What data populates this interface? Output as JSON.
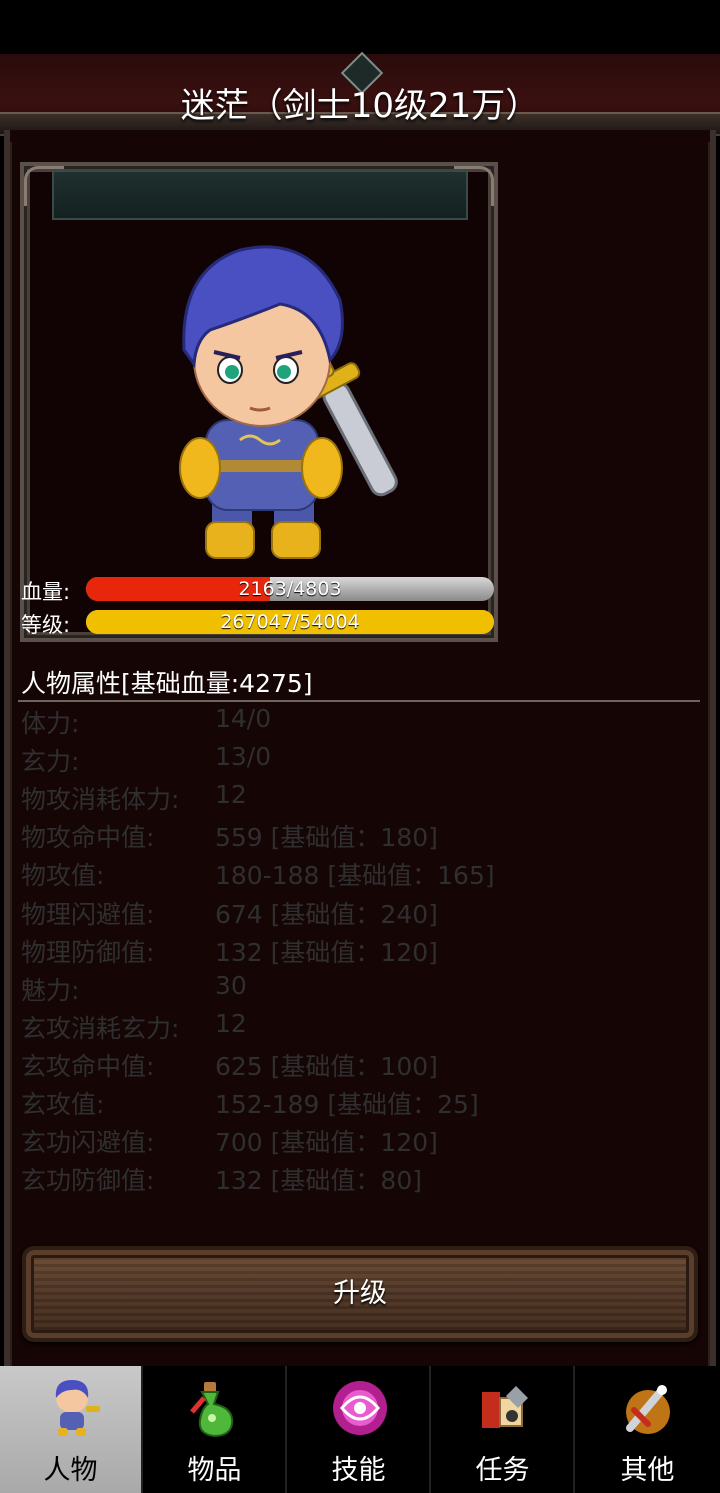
{
  "header": {
    "title": "迷茫（剑士10级21万）"
  },
  "stats": {
    "hp_label": "血量:",
    "hp_text": "2163/4803",
    "hp_fraction": 0.45,
    "level_label": "等级:",
    "level_text": "267047/54004",
    "level_fraction": 1.0
  },
  "attributes": {
    "heading": "人物属性[基础血量:4275]",
    "rows": [
      {
        "label": "体力:",
        "value": "14/0"
      },
      {
        "label": "玄力:",
        "value": "13/0"
      },
      {
        "label": "物攻消耗体力:",
        "value": "12"
      },
      {
        "label": "物攻命中值:",
        "value": "559 [基础值：180]"
      },
      {
        "label": "物攻值:",
        "value": "180-188 [基础值：165]"
      },
      {
        "label": "物理闪避值:",
        "value": "674 [基础值：240]"
      },
      {
        "label": "物理防御值:",
        "value": "132 [基础值：120]"
      },
      {
        "label": "魅力:",
        "value": "30"
      },
      {
        "label": "玄攻消耗玄力:",
        "value": "12"
      },
      {
        "label": "玄攻命中值:",
        "value": "625 [基础值：100]"
      },
      {
        "label": "玄攻值:",
        "value": "152-189 [基础值：25]"
      },
      {
        "label": "玄功闪避值:",
        "value": "700 [基础值：120]"
      },
      {
        "label": "玄功防御值:",
        "value": "132 [基础值：80]"
      }
    ]
  },
  "upgrade_button": {
    "label": "升级"
  },
  "tabs": [
    {
      "label": "人物",
      "icon": "character-icon",
      "active": true
    },
    {
      "label": "物品",
      "icon": "potion-icon",
      "active": false
    },
    {
      "label": "技能",
      "icon": "skill-orb-icon",
      "active": false
    },
    {
      "label": "任务",
      "icon": "quest-icon",
      "active": false
    },
    {
      "label": "其他",
      "icon": "other-sword-icon",
      "active": false
    }
  ],
  "colors": {
    "hp_bar": "#e8260c",
    "level_bar": "#f0c000",
    "panel_bg": "#150505",
    "attr_text": "#2f2f2f"
  }
}
